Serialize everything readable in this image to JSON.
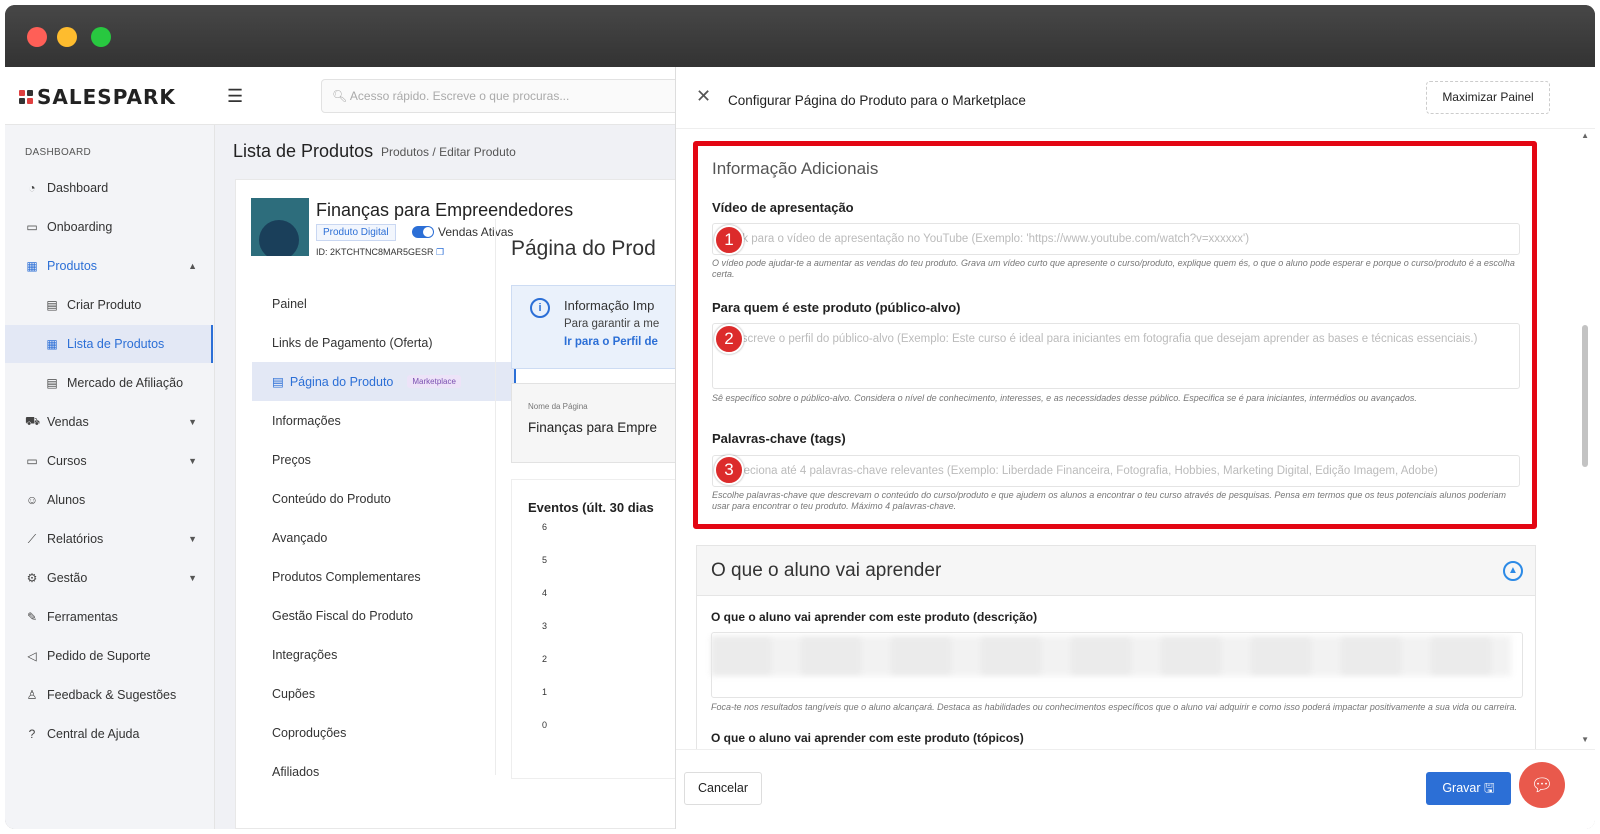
{
  "window": {
    "dots": [
      "#ff5f57",
      "#febc2e",
      "#28c840"
    ]
  },
  "brand": {
    "name": "SALESPARK"
  },
  "search": {
    "placeholder": "Acesso rápido. Escreve o que procuras..."
  },
  "sidebar": {
    "heading": "DASHBOARD",
    "items": [
      {
        "label": "Dashboard",
        "icon": "dashboard-icon"
      },
      {
        "label": "Onboarding",
        "icon": "onboarding-icon"
      },
      {
        "label": "Produtos",
        "icon": "grid-icon"
      },
      {
        "label": "Criar Produto",
        "icon": "file-icon"
      },
      {
        "label": "Lista de Produtos",
        "icon": "table-icon"
      },
      {
        "label": "Mercado de Afiliação",
        "icon": "store-icon"
      },
      {
        "label": "Vendas",
        "icon": "cart-icon"
      },
      {
        "label": "Cursos",
        "icon": "monitor-icon"
      },
      {
        "label": "Alunos",
        "icon": "users-icon"
      },
      {
        "label": "Relatórios",
        "icon": "chart-icon"
      },
      {
        "label": "Gestão",
        "icon": "gear-icon"
      },
      {
        "label": "Ferramentas",
        "icon": "wrench-icon"
      },
      {
        "label": "Pedido de Suporte",
        "icon": "megaphone-icon"
      },
      {
        "label": "Feedback & Sugestões",
        "icon": "bulb-icon"
      },
      {
        "label": "Central de Ajuda",
        "icon": "help-icon"
      }
    ]
  },
  "page": {
    "title": "Lista de Produtos",
    "crumb1": "Produtos",
    "crumb_sep": "/",
    "crumb2": "Editar Produto"
  },
  "product": {
    "name": "Finanças para Empreendedores",
    "type": "Produto Digital",
    "toggle_label": "Vendas Ativas",
    "id": "ID: 2KTCHTNC8MAR5GESR"
  },
  "product_nav": {
    "items": [
      "Painel",
      "Links de Pagamento (Oferta)",
      "Página do Produto",
      "Informações",
      "Preços",
      "Conteúdo do Produto",
      "Avançado",
      "Produtos Complementares",
      "Gestão Fiscal do Produto",
      "Integrações",
      "Cupões",
      "Coproduções",
      "Afiliados"
    ],
    "marketplace_badge": "Marketplace"
  },
  "content": {
    "heading": "Página do Prod",
    "info_title": "Informação Imp",
    "info_text": "Para garantir a me",
    "info_link": "Ir para o Perfil de",
    "name_label": "Nome da Página",
    "name_value": "Finanças para Empre",
    "events_title": "Eventos (últ. 30 dias",
    "events_ticks": [
      "6",
      "5",
      "4",
      "3",
      "2",
      "1",
      "0"
    ]
  },
  "panel": {
    "title": "Configurar Página do Produto para o Marketplace",
    "maximize": "Maximizar Painel",
    "section1_title": "Informação Adicionais",
    "video_label": "Vídeo de apresentação",
    "video_placeholder": "Link para o vídeo de apresentação no YouTube (Exemplo: 'https://www.youtube.com/watch?v=xxxxxx')",
    "video_help": "O vídeo pode ajudar-te a aumentar as vendas do teu produto. Grava um vídeo curto que apresente o curso/produto, explique quem és, o que o aluno pode esperar e porque o curso/produto é a escolha certa.",
    "audience_label": "Para quem é este produto (público-alvo)",
    "audience_placeholder": "Descreve o perfil do público-alvo (Exemplo: Este curso é ideal para iniciantes em fotografia que desejam aprender as bases e técnicas essenciais.)",
    "audience_help": "Sê específico sobre o público-alvo. Considera o nível de conhecimento, interesses, e as necessidades desse público. Especifica se é para iniciantes, intermédios ou avançados.",
    "tags_label": "Palavras-chave (tags)",
    "tags_placeholder": "Seleciona até 4 palavras-chave relevantes (Exemplo: Liberdade Financeira, Fotografia, Hobbies, Marketing Digital, Edição Imagem, Adobe)",
    "tags_help": "Escolhe palavras-chave que descrevam o conteúdo do curso/produto e que ajudem os alunos a encontrar o teu curso através de pesquisas. Pensa em termos que os teus potenciais alunos poderiam usar para encontrar o teu produto. Máximo 4 palavras-chave.",
    "markers": [
      "1",
      "2",
      "3"
    ],
    "section2_title": "O que o aluno vai aprender",
    "learn_label": "O que o aluno vai aprender com este produto (descrição)",
    "learn_help": "Foca-te nos resultados tangíveis que o aluno alcançará. Destaca as habilidades ou conhecimentos específicos que o aluno vai adquirir e como isso poderá impactar positivamente a sua vida ou carreira.",
    "topics_label": "O que o aluno vai aprender com este produto (tópicos)",
    "cancel": "Cancelar",
    "save": "Gravar"
  },
  "colors": {
    "accent": "#2c6fd6",
    "highlight": "#e30613"
  }
}
